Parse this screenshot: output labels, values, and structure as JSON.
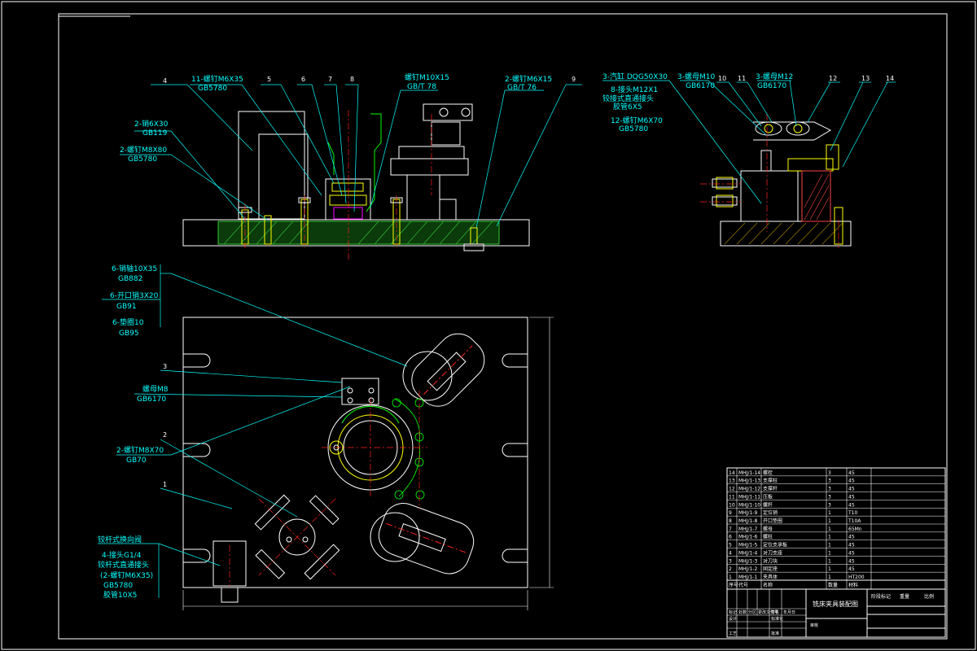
{
  "colors": {
    "background": "#000000",
    "outline": "#ffffff",
    "leader": "#00ffff",
    "centerline": "#ff2020",
    "section_hatch": "#33cc33",
    "part": "#00ff00",
    "bolt": "#ffff00",
    "accent": "#ff00ff"
  },
  "top_view_labels": {
    "n4": "4",
    "n11": "11-螺钉M6X35",
    "n11_std": "GB5780",
    "n5": "5",
    "n6": "6",
    "n7": "7",
    "n8": "8",
    "screw_m10": "螺钉M10X15",
    "screw_m10_std": "GB/T 78",
    "n2_screw": "2-螺钉M6X15",
    "n2_screw_std": "GB/T 76",
    "n9": "9",
    "pin": "2-销6X30",
    "pin_std": "GB119",
    "screw_m8": "2-螺钉M8X80",
    "screw_m8_std": "GB5780"
  },
  "side_view_labels": {
    "cylinder": "3-汽缸  DQG50X30",
    "joint": "8-接头M12X1",
    "straight_joint": "铰接式直通接头",
    "hose": "胶管6X5",
    "screw12": "12-螺钉M6X70",
    "screw12_std": "GB5780",
    "nut": "3-螺母M10",
    "nut_std": "GB6170",
    "nut2": "3-螺母M12",
    "nut2_std": "GB6170",
    "n10": "10",
    "n11": "11",
    "n12": "12",
    "n13": "13",
    "n14": "14"
  },
  "plan_view_labels": {
    "pinshaft": "6-销轴10X35",
    "pinshaft_std": "GB882",
    "cotter": "6-开口销3X20",
    "cotter_std": "GB91",
    "washer": "6-垫圈10",
    "washer_std": "GB95",
    "n3": "3",
    "nut_m8": "螺母M8",
    "nut_m8_std": "GB6170",
    "n2": "2",
    "screw70": "2-螺钉M8X70",
    "screw70_std": "GB70",
    "n1": "1",
    "valve": "铰杆式换向阀",
    "joint_g": "4-接头G1/4",
    "straight_joint": "铰杆式直通接头",
    "screw_m6": "(2-螺钉M6X35)",
    "screw_m6_std": "GB5780",
    "hose": "胶管10X5"
  },
  "title_block": {
    "drawing_title": "铣床夹具装配图",
    "parts_header": [
      "序号",
      "代号",
      "名称",
      "数量",
      "材料"
    ],
    "parts": [
      {
        "no": "14",
        "code": "MHJ/1-14",
        "name": "螺栓",
        "qty": "3",
        "mat": "45"
      },
      {
        "no": "13",
        "code": "MHJ/1-13",
        "name": "支撑柱",
        "qty": "3",
        "mat": "45"
      },
      {
        "no": "12",
        "code": "MHJ/1-12",
        "name": "支撑杆",
        "qty": "3",
        "mat": "45"
      },
      {
        "no": "11",
        "code": "MHJ/1-11",
        "name": "压板",
        "qty": "3",
        "mat": "45"
      },
      {
        "no": "10",
        "code": "MHJ/1-10",
        "name": "螺杆",
        "qty": "3",
        "mat": "45"
      },
      {
        "no": "9",
        "code": "MHJ/1-9",
        "name": "定位销",
        "qty": "1",
        "mat": "T10"
      },
      {
        "no": "8",
        "code": "MHJ/1-8",
        "name": "开口垫圈",
        "qty": "1",
        "mat": "T10A"
      },
      {
        "no": "7",
        "code": "MHJ/1-7",
        "name": "螺母",
        "qty": "1",
        "mat": "65Mn"
      },
      {
        "no": "6",
        "code": "MHJ/1-6",
        "name": "螺柱",
        "qty": "1",
        "mat": "45"
      },
      {
        "no": "5",
        "code": "MHJ/1-5",
        "name": "定位支承板",
        "qty": "1",
        "mat": "45"
      },
      {
        "no": "4",
        "code": "MHJ/1-4",
        "name": "对刀支座",
        "qty": "1",
        "mat": "45"
      },
      {
        "no": "3",
        "code": "MHJ/1-3",
        "name": "对刀块",
        "qty": "1",
        "mat": "45"
      },
      {
        "no": "2",
        "code": "MHJ/1-2",
        "name": "固定座",
        "qty": "1",
        "mat": "45"
      },
      {
        "no": "1",
        "code": "MHJ/1-1",
        "name": "夹具体",
        "qty": "1",
        "mat": "HT200"
      }
    ],
    "footer_cells": [
      "标记",
      "处数",
      "分区",
      "更改文件号",
      "签名",
      "年月日"
    ],
    "roles": [
      "设计",
      "审核",
      "工艺",
      "标准化",
      "批准"
    ],
    "stage": "阶段标记",
    "weight": "重量",
    "scale": "比例"
  }
}
